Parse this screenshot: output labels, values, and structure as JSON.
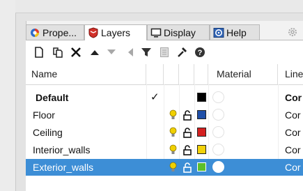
{
  "tabs": [
    {
      "label": "Prope...",
      "icon": "properties-icon"
    },
    {
      "label": "Layers",
      "icon": "layers-icon"
    },
    {
      "label": "Display",
      "icon": "display-icon"
    },
    {
      "label": "Help",
      "icon": "help-icon"
    }
  ],
  "toolbar": {
    "items": [
      "new-layer-icon",
      "new-sublayer-icon",
      "delete-icon",
      "move-up-icon",
      "move-down-icon",
      "move-left-icon",
      "filter-icon",
      "layer-state-icon",
      "tools-icon",
      "help-icon"
    ]
  },
  "columns": {
    "name": "Name",
    "material": "Material",
    "linetype": "Line"
  },
  "layers": [
    {
      "name": "Default",
      "current": "✓",
      "color": "#000000",
      "linetype": "Cor",
      "bold": true,
      "selected": false
    },
    {
      "name": "Floor",
      "current": "",
      "color": "#1f4fa8",
      "linetype": "Cor",
      "bold": false,
      "selected": false
    },
    {
      "name": "Ceiling",
      "current": "",
      "color": "#d42020",
      "linetype": "Cor",
      "bold": false,
      "selected": false
    },
    {
      "name": "Interior_walls",
      "current": "",
      "color": "#f2d20a",
      "linetype": "Cor",
      "bold": false,
      "selected": false
    },
    {
      "name": "Exterior_walls",
      "current": "",
      "color": "#5cbf2a",
      "linetype": "Cor",
      "bold": false,
      "selected": true
    }
  ],
  "colors": {
    "selection": "#3d8ed6",
    "bulb": "#f0d000"
  }
}
